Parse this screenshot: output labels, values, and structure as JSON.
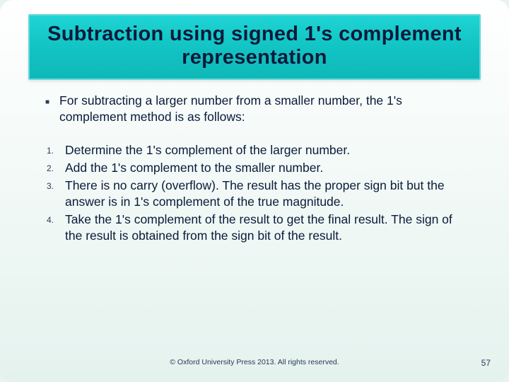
{
  "title": "Subtraction using signed 1's complement representation",
  "intro": "For subtracting a larger number from a smaller number, the 1's complement method is as follows:",
  "steps": [
    {
      "n": "1.",
      "text": "Determine the 1's complement of the larger number."
    },
    {
      "n": "2.",
      "text": "Add the 1's complement to the smaller number."
    },
    {
      "n": "3.",
      "text": "There is no carry (overflow). The result has the proper sign bit but the answer is in 1's complement of the true magnitude."
    },
    {
      "n": "4.",
      "text": "Take the 1's complement of the result to get the final result. The sign of the result is obtained from the sign bit of the result."
    }
  ],
  "footer": "© Oxford University Press 2013. All rights reserved.",
  "page_number": "57"
}
